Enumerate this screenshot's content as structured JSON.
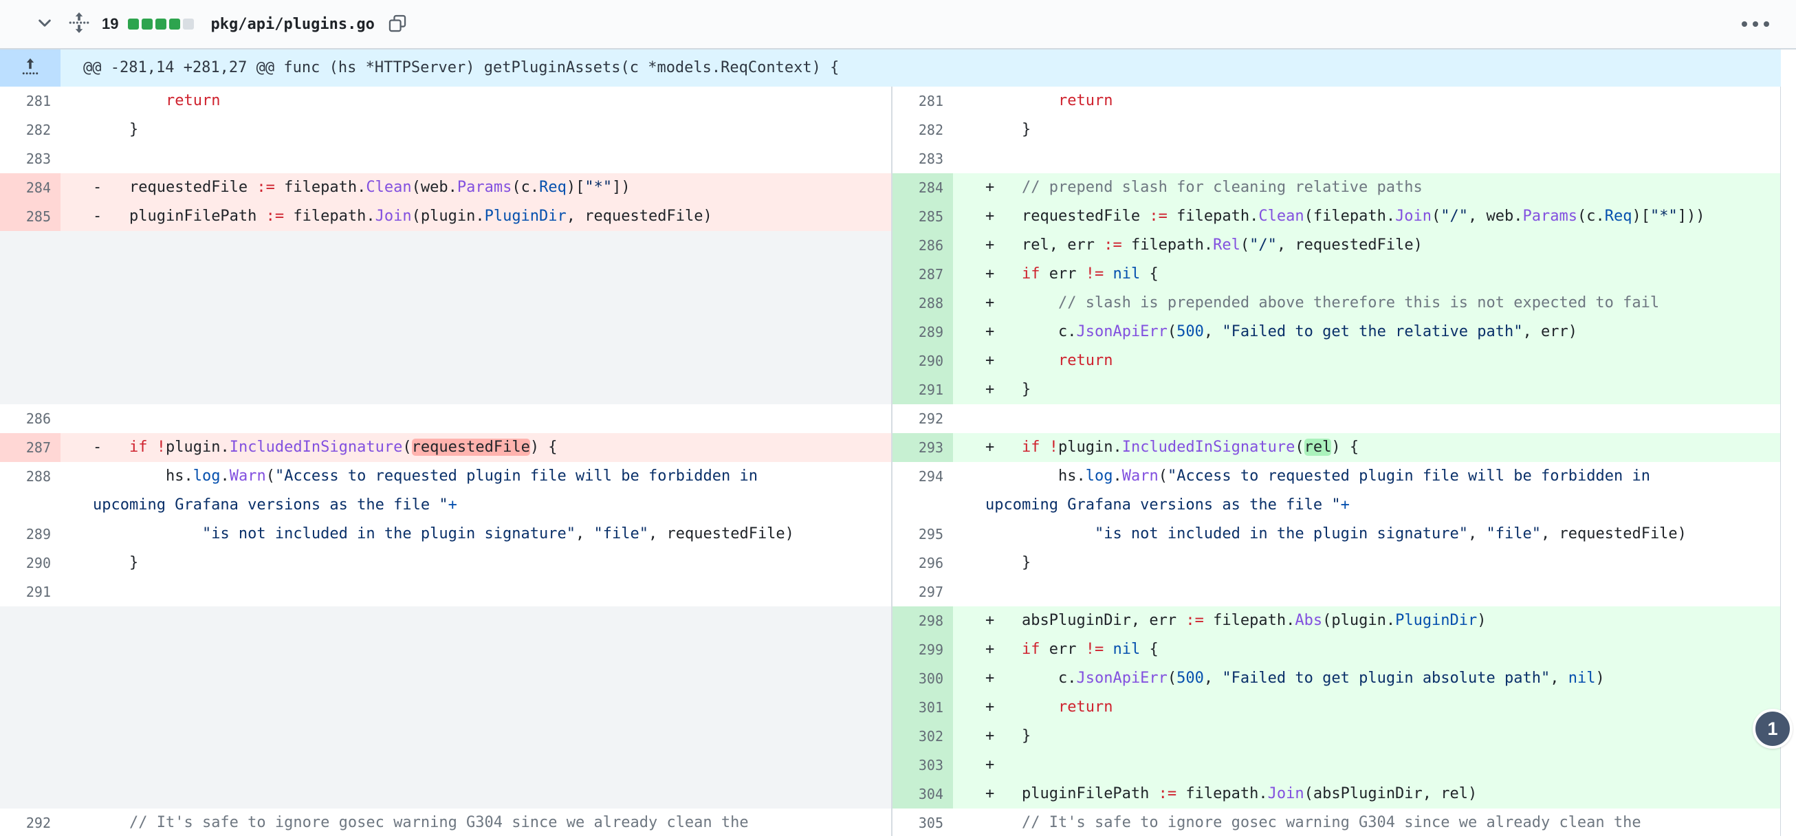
{
  "header": {
    "count": "19",
    "filename": "pkg/api/plugins.go",
    "blocks": [
      "add",
      "add",
      "add",
      "add",
      "neutral"
    ]
  },
  "hunk": {
    "text": "@@ -281,14 +281,27 @@ func (hs *HTTPServer) getPluginAssets(c *models.ReqContext) {"
  },
  "badge": {
    "label": "1"
  },
  "colors": {
    "addition_green": "#2da44e",
    "addition_line_bg": "#e6ffec",
    "addition_num_bg": "#c7f0d2",
    "addition_word_bg": "#abf2bc",
    "deletion_line_bg": "#ffebe9",
    "deletion_num_bg": "#ffd7d5",
    "deletion_word_bg": "#ffb3ae",
    "hunk_bg": "#ddf4ff",
    "hunk_gutter_bg": "#bcdfff",
    "badge_bg": "#46566f",
    "keyword": "#cf222e",
    "function": "#8250df",
    "constant": "#0550ae",
    "string": "#0a3069",
    "comment": "#6e7781"
  },
  "diff": {
    "rows": [
      {
        "l": {
          "n": "281",
          "type": "ctx",
          "code": [
            [
              "t",
              "        "
            ],
            [
              "k",
              "return"
            ]
          ]
        },
        "r": {
          "n": "281",
          "type": "ctx",
          "code": [
            [
              "t",
              "        "
            ],
            [
              "k",
              "return"
            ]
          ]
        }
      },
      {
        "l": {
          "n": "282",
          "type": "ctx",
          "code": [
            [
              "t",
              "    }"
            ]
          ]
        },
        "r": {
          "n": "282",
          "type": "ctx",
          "code": [
            [
              "t",
              "    }"
            ]
          ]
        }
      },
      {
        "l": {
          "n": "283",
          "type": "ctx",
          "code": []
        },
        "r": {
          "n": "283",
          "type": "ctx",
          "code": []
        }
      },
      {
        "l": {
          "n": "284",
          "type": "del",
          "sign": "-",
          "code": [
            [
              "t",
              "    requestedFile "
            ],
            [
              "k",
              ":="
            ],
            [
              "t",
              " filepath."
            ],
            [
              "en",
              "Clean"
            ],
            [
              "t",
              "(web."
            ],
            [
              "en",
              "Params"
            ],
            [
              "t",
              "(c."
            ],
            [
              "c1",
              "Req"
            ],
            [
              "t",
              ")["
            ],
            [
              "s",
              "\"*\""
            ],
            [
              "t",
              "])"
            ]
          ]
        },
        "r": {
          "n": "284",
          "type": "add",
          "sign": "+",
          "code": [
            [
              "t",
              "    "
            ],
            [
              "c",
              "// prepend slash for cleaning relative paths"
            ]
          ]
        }
      },
      {
        "l": {
          "n": "285",
          "type": "del",
          "sign": "-",
          "code": [
            [
              "t",
              "    pluginFilePath "
            ],
            [
              "k",
              ":="
            ],
            [
              "t",
              " filepath."
            ],
            [
              "en",
              "Join"
            ],
            [
              "t",
              "(plugin."
            ],
            [
              "c1",
              "PluginDir"
            ],
            [
              "t",
              ", requestedFile)"
            ]
          ]
        },
        "r": {
          "n": "285",
          "type": "add",
          "sign": "+",
          "code": [
            [
              "t",
              "    requestedFile "
            ],
            [
              "k",
              ":="
            ],
            [
              "t",
              " filepath."
            ],
            [
              "en",
              "Clean"
            ],
            [
              "t",
              "(filepath."
            ],
            [
              "en",
              "Join"
            ],
            [
              "t",
              "("
            ],
            [
              "s",
              "\"/\""
            ],
            [
              "t",
              ", web."
            ],
            [
              "en",
              "Params"
            ],
            [
              "t",
              "(c."
            ],
            [
              "c1",
              "Req"
            ],
            [
              "t",
              ")["
            ],
            [
              "s",
              "\"*\""
            ],
            [
              "t",
              "]))"
            ]
          ]
        }
      },
      {
        "l": {
          "type": "empty",
          "code": []
        },
        "r": {
          "n": "286",
          "type": "add",
          "sign": "+",
          "code": [
            [
              "t",
              "    rel, err "
            ],
            [
              "k",
              ":="
            ],
            [
              "t",
              " filepath."
            ],
            [
              "en",
              "Rel"
            ],
            [
              "t",
              "("
            ],
            [
              "s",
              "\"/\""
            ],
            [
              "t",
              ", requestedFile)"
            ]
          ]
        }
      },
      {
        "l": {
          "type": "empty",
          "code": []
        },
        "r": {
          "n": "287",
          "type": "add",
          "sign": "+",
          "code": [
            [
              "t",
              "    "
            ],
            [
              "k",
              "if"
            ],
            [
              "t",
              " err "
            ],
            [
              "k",
              "!="
            ],
            [
              "t",
              " "
            ],
            [
              "c1",
              "nil"
            ],
            [
              "t",
              " {"
            ]
          ]
        }
      },
      {
        "l": {
          "type": "empty",
          "code": []
        },
        "r": {
          "n": "288",
          "type": "add",
          "sign": "+",
          "code": [
            [
              "t",
              "        "
            ],
            [
              "c",
              "// slash is prepended above therefore this is not expected to fail"
            ]
          ]
        }
      },
      {
        "l": {
          "type": "empty",
          "code": []
        },
        "r": {
          "n": "289",
          "type": "add",
          "sign": "+",
          "code": [
            [
              "t",
              "        c."
            ],
            [
              "en",
              "JsonApiErr"
            ],
            [
              "t",
              "("
            ],
            [
              "c1",
              "500"
            ],
            [
              "t",
              ", "
            ],
            [
              "s",
              "\"Failed to get the relative path\""
            ],
            [
              "t",
              ", err)"
            ]
          ]
        }
      },
      {
        "l": {
          "type": "empty",
          "code": []
        },
        "r": {
          "n": "290",
          "type": "add",
          "sign": "+",
          "code": [
            [
              "t",
              "        "
            ],
            [
              "k",
              "return"
            ]
          ]
        }
      },
      {
        "l": {
          "type": "empty",
          "code": []
        },
        "r": {
          "n": "291",
          "type": "add",
          "sign": "+",
          "code": [
            [
              "t",
              "    }"
            ]
          ]
        }
      },
      {
        "l": {
          "n": "286",
          "type": "ctx",
          "code": []
        },
        "r": {
          "n": "292",
          "type": "ctx",
          "code": []
        }
      },
      {
        "l": {
          "n": "287",
          "type": "del",
          "sign": "-",
          "code": [
            [
              "t",
              "    "
            ],
            [
              "k",
              "if"
            ],
            [
              "t",
              " "
            ],
            [
              "k",
              "!"
            ],
            [
              "t",
              "plugin."
            ],
            [
              "en",
              "IncludedInSignature"
            ],
            [
              "t",
              "("
            ],
            [
              "dw",
              "requestedFile"
            ],
            [
              "t",
              ") {"
            ]
          ]
        },
        "r": {
          "n": "293",
          "type": "add",
          "sign": "+",
          "code": [
            [
              "t",
              "    "
            ],
            [
              "k",
              "if"
            ],
            [
              "t",
              " "
            ],
            [
              "k",
              "!"
            ],
            [
              "t",
              "plugin."
            ],
            [
              "en",
              "IncludedInSignature"
            ],
            [
              "t",
              "("
            ],
            [
              "aw",
              "rel"
            ],
            [
              "t",
              ") {"
            ]
          ]
        }
      },
      {
        "l": {
          "n": "288",
          "type": "ctx",
          "code": [
            [
              "t",
              "        hs."
            ],
            [
              "c1",
              "log"
            ],
            [
              "t",
              "."
            ],
            [
              "en",
              "Warn"
            ],
            [
              "t",
              "("
            ],
            [
              "s",
              "\"Access to requested plugin file will be forbidden in\nupcoming Grafana versions as the file \""
            ],
            [
              "c1",
              "+"
            ]
          ]
        },
        "r": {
          "n": "294",
          "type": "ctx",
          "code": [
            [
              "t",
              "        hs."
            ],
            [
              "c1",
              "log"
            ],
            [
              "t",
              "."
            ],
            [
              "en",
              "Warn"
            ],
            [
              "t",
              "("
            ],
            [
              "s",
              "\"Access to requested plugin file will be forbidden in\nupcoming Grafana versions as the file \""
            ],
            [
              "c1",
              "+"
            ]
          ]
        }
      },
      {
        "l": {
          "n": "289",
          "type": "ctx",
          "code": [
            [
              "t",
              "            "
            ],
            [
              "s",
              "\"is not included in the plugin signature\""
            ],
            [
              "t",
              ", "
            ],
            [
              "s",
              "\"file\""
            ],
            [
              "t",
              ", requestedFile)"
            ]
          ]
        },
        "r": {
          "n": "295",
          "type": "ctx",
          "code": [
            [
              "t",
              "            "
            ],
            [
              "s",
              "\"is not included in the plugin signature\""
            ],
            [
              "t",
              ", "
            ],
            [
              "s",
              "\"file\""
            ],
            [
              "t",
              ", requestedFile)"
            ]
          ]
        }
      },
      {
        "l": {
          "n": "290",
          "type": "ctx",
          "code": [
            [
              "t",
              "    }"
            ]
          ]
        },
        "r": {
          "n": "296",
          "type": "ctx",
          "code": [
            [
              "t",
              "    }"
            ]
          ]
        }
      },
      {
        "l": {
          "n": "291",
          "type": "ctx",
          "code": []
        },
        "r": {
          "n": "297",
          "type": "ctx",
          "code": []
        }
      },
      {
        "l": {
          "type": "empty",
          "code": []
        },
        "r": {
          "n": "298",
          "type": "add",
          "sign": "+",
          "code": [
            [
              "t",
              "    absPluginDir, err "
            ],
            [
              "k",
              ":="
            ],
            [
              "t",
              " filepath."
            ],
            [
              "en",
              "Abs"
            ],
            [
              "t",
              "(plugin."
            ],
            [
              "c1",
              "PluginDir"
            ],
            [
              "t",
              ")"
            ]
          ]
        }
      },
      {
        "l": {
          "type": "empty",
          "code": []
        },
        "r": {
          "n": "299",
          "type": "add",
          "sign": "+",
          "code": [
            [
              "t",
              "    "
            ],
            [
              "k",
              "if"
            ],
            [
              "t",
              " err "
            ],
            [
              "k",
              "!="
            ],
            [
              "t",
              " "
            ],
            [
              "c1",
              "nil"
            ],
            [
              "t",
              " {"
            ]
          ]
        }
      },
      {
        "l": {
          "type": "empty",
          "code": []
        },
        "r": {
          "n": "300",
          "type": "add",
          "sign": "+",
          "code": [
            [
              "t",
              "        c."
            ],
            [
              "en",
              "JsonApiErr"
            ],
            [
              "t",
              "("
            ],
            [
              "c1",
              "500"
            ],
            [
              "t",
              ", "
            ],
            [
              "s",
              "\"Failed to get plugin absolute path\""
            ],
            [
              "t",
              ", "
            ],
            [
              "c1",
              "nil"
            ],
            [
              "t",
              ")"
            ]
          ]
        }
      },
      {
        "l": {
          "type": "empty",
          "code": []
        },
        "r": {
          "n": "301",
          "type": "add",
          "sign": "+",
          "code": [
            [
              "t",
              "        "
            ],
            [
              "k",
              "return"
            ]
          ]
        }
      },
      {
        "l": {
          "type": "empty",
          "code": []
        },
        "r": {
          "n": "302",
          "type": "add",
          "sign": "+",
          "code": [
            [
              "t",
              "    }"
            ]
          ]
        }
      },
      {
        "l": {
          "type": "empty",
          "code": []
        },
        "r": {
          "n": "303",
          "type": "add",
          "sign": "+",
          "code": []
        }
      },
      {
        "l": {
          "type": "empty",
          "code": []
        },
        "r": {
          "n": "304",
          "type": "add",
          "sign": "+",
          "code": [
            [
              "t",
              "    pluginFilePath "
            ],
            [
              "k",
              ":="
            ],
            [
              "t",
              " filepath."
            ],
            [
              "en",
              "Join"
            ],
            [
              "t",
              "(absPluginDir, rel)"
            ]
          ]
        }
      },
      {
        "l": {
          "n": "292",
          "type": "ctx",
          "code": [
            [
              "t",
              "    "
            ],
            [
              "c",
              "// It's safe to ignore gosec warning G304 since we already clean the"
            ]
          ]
        },
        "r": {
          "n": "305",
          "type": "ctx",
          "code": [
            [
              "t",
              "    "
            ],
            [
              "c",
              "// It's safe to ignore gosec warning G304 since we already clean the"
            ]
          ]
        }
      }
    ]
  }
}
